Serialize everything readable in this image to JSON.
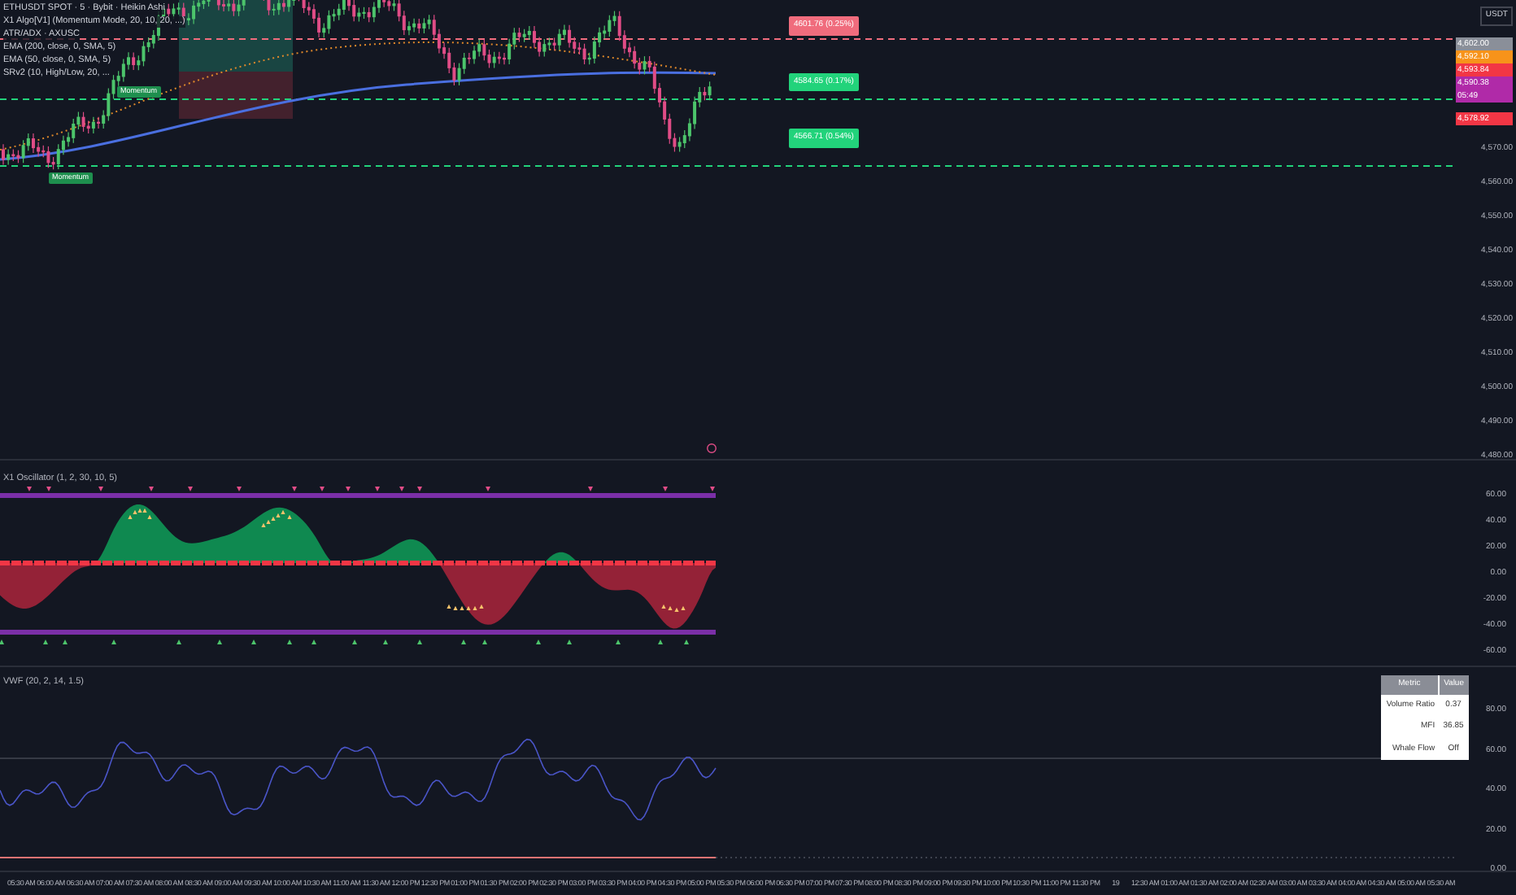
{
  "legend": {
    "symbol": "ETHUSDT SPOT · 5 · Bybit · Heikin Ashi",
    "indicators": [
      "X1 Algo[V1] (Momentum Mode, 20, 10, 20, ...)",
      "ATR/ADX · AXUSC",
      "EMA (200, close, 0, SMA, 5)",
      "EMA (50, close, 0, SMA, 5)",
      "SRv2 (10, High/Low, 20, ..."
    ]
  },
  "signal_tags": [
    "Momentum",
    "Momentum"
  ],
  "levels": [
    {
      "label": "4601.76 (0.25%)",
      "color": "#f06c7d"
    },
    {
      "label": "4584.65 (0.17%)",
      "color": "#22d37b"
    },
    {
      "label": "4566.71 (0.54%)",
      "color": "#22d37b"
    }
  ],
  "price_axis": {
    "currency": "USDT",
    "tags": [
      {
        "text": "4,602.00",
        "color": "#8a8f99"
      },
      {
        "text": "4,592.10",
        "color": "#f7931a"
      },
      {
        "text": "4,593.84",
        "color": "#f23645"
      },
      {
        "text": "4,590.38",
        "sub": "05:49",
        "color": "#b02aa8"
      },
      {
        "text": "4,578.92",
        "color": "#f23645"
      }
    ],
    "ticks": [
      "4,570.00",
      "4,560.00",
      "4,550.00",
      "4,540.00",
      "4,530.00",
      "4,520.00",
      "4,510.00",
      "4,500.00",
      "4,490.00",
      "4,480.00"
    ]
  },
  "oscillator": {
    "title": "X1 Oscillator (1, 2, 30, 10, 5)",
    "ticks": [
      "60.00",
      "40.00",
      "20.00",
      "0.00",
      "-20.00",
      "-40.00",
      "-60.00"
    ]
  },
  "vwf": {
    "title": "VWF (20, 2, 14, 1.5)",
    "ticks": [
      "80.00",
      "60.00",
      "40.00",
      "20.00",
      "0.00"
    ],
    "table": {
      "columns": [
        "Metric",
        "Value"
      ],
      "rows": [
        [
          "Volume Ratio",
          "0.37"
        ],
        [
          "MFI",
          "36.85"
        ],
        [
          "Whale Flow",
          "Off"
        ]
      ]
    }
  },
  "time_axis": [
    "05:30 AM",
    "06:00 AM",
    "06:30 AM",
    "07:00 AM",
    "07:30 AM",
    "08:00 AM",
    "08:30 AM",
    "09:00 AM",
    "09:30 AM",
    "10:00 AM",
    "10:30 AM",
    "11:00 AM",
    "11:30 AM",
    "12:00 PM",
    "12:30 PM",
    "01:00 PM",
    "01:30 PM",
    "02:00 PM",
    "02:30 PM",
    "03:00 PM",
    "03:30 PM",
    "04:00 PM",
    "04:30 PM",
    "05:00 PM",
    "05:30 PM",
    "06:00 PM",
    "06:30 PM",
    "07:00 PM",
    "07:30 PM",
    "08:00 PM",
    "08:30 PM",
    "09:00 PM",
    "09:30 PM",
    "10:00 PM",
    "10:30 PM",
    "11:00 PM",
    "11:30 PM",
    "19",
    "12:30 AM",
    "01:00 AM",
    "01:30 AM",
    "02:00 AM",
    "02:30 AM",
    "03:00 AM",
    "03:30 AM",
    "04:00 AM",
    "04:30 AM",
    "05:00 AM",
    "05:30 AM"
  ]
}
